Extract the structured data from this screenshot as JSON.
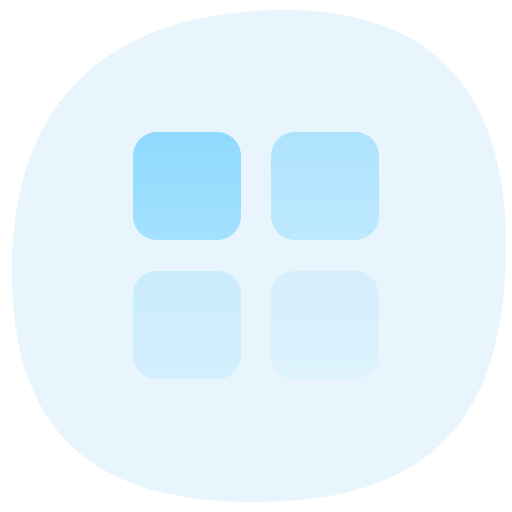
{
  "icon": {
    "name": "app-grid-icon",
    "colors": {
      "backdrop": "#e9f5fd",
      "tile_top_left": [
        "#8fdaff",
        "#a3e1fe"
      ],
      "tile_top_right": [
        "#ade3fd",
        "#bde9fe"
      ],
      "tile_bottom_left": [
        "#c9ecfd",
        "#d3effd"
      ],
      "tile_bottom_right": [
        "#d5effd",
        "#ddf2fd"
      ]
    }
  }
}
